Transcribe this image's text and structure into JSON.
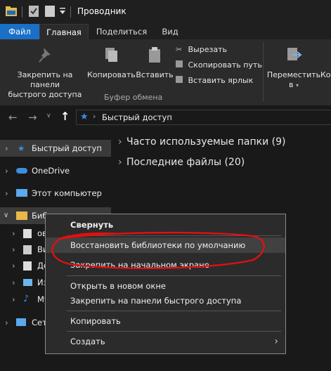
{
  "window": {
    "title": "Проводник"
  },
  "ribbon_tabs": [
    "Файл",
    "Главная",
    "Поделиться",
    "Вид"
  ],
  "ribbon": {
    "pin_label_1": "Закрепить на панели",
    "pin_label_2": "быстрого доступа",
    "copy_label": "Копировать",
    "paste_label": "Вставить",
    "cut_label": "Вырезать",
    "copy_path_label": "Скопировать путь",
    "paste_shortcut_label": "Вставить ярлык",
    "group_label": "Буфер обмена",
    "move_label_1": "Переместить",
    "move_label_2": "в",
    "copy_to_partial": "Ко"
  },
  "address": {
    "path": "Быстрый доступ"
  },
  "nav": {
    "quick_access": "Быстрый доступ",
    "onedrive": "OneDrive",
    "this_pc": "Этот компьютер",
    "libraries": "Библиотеки",
    "lib_item_1": "ов",
    "lib_item_2": "Ви",
    "lib_item_3": "До",
    "lib_item_4": "Из",
    "lib_item_5": "Му",
    "network": "Сет"
  },
  "main": {
    "frequent_folders": "Часто используемые папки (9)",
    "recent_files": "Последние файлы (20)"
  },
  "context_menu": {
    "collapse": "Свернуть",
    "restore_libraries": "Восстановить библиотеки по умолчанию",
    "pin_start": "Закрепить на начальном экране",
    "open_new_window": "Открыть в новом окне",
    "pin_quick_access": "Закрепить на панели быстрого доступа",
    "copy": "Копировать",
    "create": "Создать"
  },
  "colors": {
    "accent": "#1a6fc6",
    "annotation": "#e01010",
    "background": "#191919"
  }
}
